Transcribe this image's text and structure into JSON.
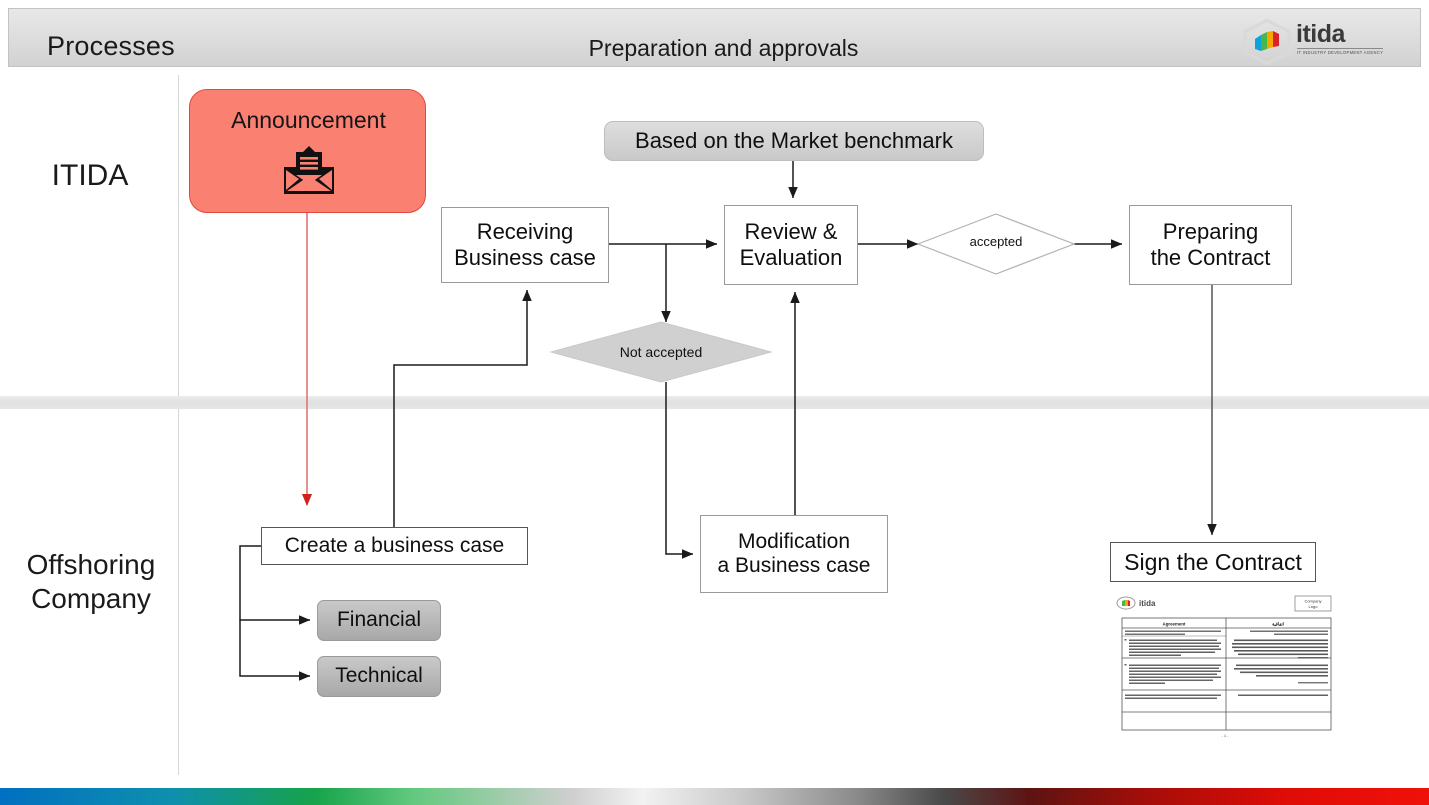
{
  "header": {
    "left_title": "Processes",
    "center_title": "Preparation and approvals",
    "logo": {
      "wordmark": "itida",
      "tagline": "IT INDUSTRY DEVELOPMENT AGENCY"
    }
  },
  "lanes": [
    {
      "id": "itida",
      "label": "ITIDA"
    },
    {
      "id": "offshoring",
      "label": "Offshoring\nCompany"
    }
  ],
  "lane_labels": {
    "itida": "ITIDA",
    "offshoring_line1": "Offshoring",
    "offshoring_line2": "Company"
  },
  "nodes": {
    "announcement": {
      "label": "Announcement",
      "icon": "mail-envelope-icon",
      "fill": "#fa8072",
      "stroke": "#e2473c",
      "shape": "rounded-rect"
    },
    "market_benchmark": {
      "label": "Based on the Market benchmark",
      "fill": "#d4d4d4",
      "shape": "rounded-rect"
    },
    "receiving": {
      "line1": "Receiving",
      "line2": "Business case",
      "shape": "rect"
    },
    "review": {
      "line1": "Review &",
      "line2": "Evaluation",
      "shape": "rect"
    },
    "preparing": {
      "line1": "Preparing",
      "line2": "the Contract",
      "shape": "rect"
    },
    "modification": {
      "line1": "Modification",
      "line2": "a Business case",
      "shape": "rect"
    },
    "create_case": {
      "label": "Create a business case",
      "shape": "rect"
    },
    "sign_contract": {
      "label": "Sign the Contract",
      "shape": "rect"
    },
    "financial": {
      "label": "Financial",
      "fill": "#b0b0b0",
      "shape": "rounded-rect"
    },
    "technical": {
      "label": "Technical",
      "fill": "#b0b0b0",
      "shape": "rounded-rect"
    }
  },
  "decisions": {
    "accepted": {
      "label": "accepted",
      "fill": "#ffffff",
      "stroke": "#b3b3b3",
      "shape": "diamond"
    },
    "not_accepted": {
      "label": "Not accepted",
      "fill": "#d0d0d0",
      "stroke": "#c4c4c4",
      "shape": "diamond"
    }
  },
  "connectors": [
    {
      "from": "announcement",
      "to": "create_case",
      "color": "#e2473c",
      "style": "straight-down-arrow"
    },
    {
      "from": "receiving",
      "to": "review",
      "color": "#1a1a1a",
      "style": "right-arrow"
    },
    {
      "from": "market_benchmark",
      "to": "review",
      "color": "#1a1a1a",
      "style": "down-arrow"
    },
    {
      "from": "review",
      "to": "accepted",
      "color": "#1a1a1a",
      "style": "right-arrow"
    },
    {
      "from": "accepted",
      "to": "preparing",
      "color": "#1a1a1a",
      "style": "right-arrow"
    },
    {
      "from": "review_branch",
      "to": "not_accepted",
      "color": "#1a1a1a",
      "style": "down-arrow"
    },
    {
      "from": "not_accepted",
      "to": "modification",
      "color": "#1a1a1a",
      "style": "down-right-arrow"
    },
    {
      "from": "modification",
      "to": "review",
      "color": "#1a1a1a",
      "style": "up-arrow"
    },
    {
      "from": "create_case",
      "to": "receiving",
      "color": "#1a1a1a",
      "style": "up-right-up-arrow"
    },
    {
      "from": "create_case",
      "to": "financial",
      "color": "#1a1a1a",
      "style": "left-down-right-arrow"
    },
    {
      "from": "create_case",
      "to": "technical",
      "color": "#1a1a1a",
      "style": "left-down-right-arrow"
    },
    {
      "from": "preparing",
      "to": "sign_contract",
      "color": "#1a1a1a",
      "style": "down-arrow"
    }
  ],
  "contract_thumbnail": {
    "logo_text": "itida",
    "company_logo_line1": "Company",
    "company_logo_line2": "Logo",
    "col_header_en": "Agreement",
    "col_header_ar": "اتفاقية",
    "page_number": "- 1 -"
  },
  "bottom_bar": {
    "colors": [
      "#0070c0",
      "#16a34a",
      "#f2f2f2",
      "#4a4a4a",
      "#ef1109"
    ]
  }
}
